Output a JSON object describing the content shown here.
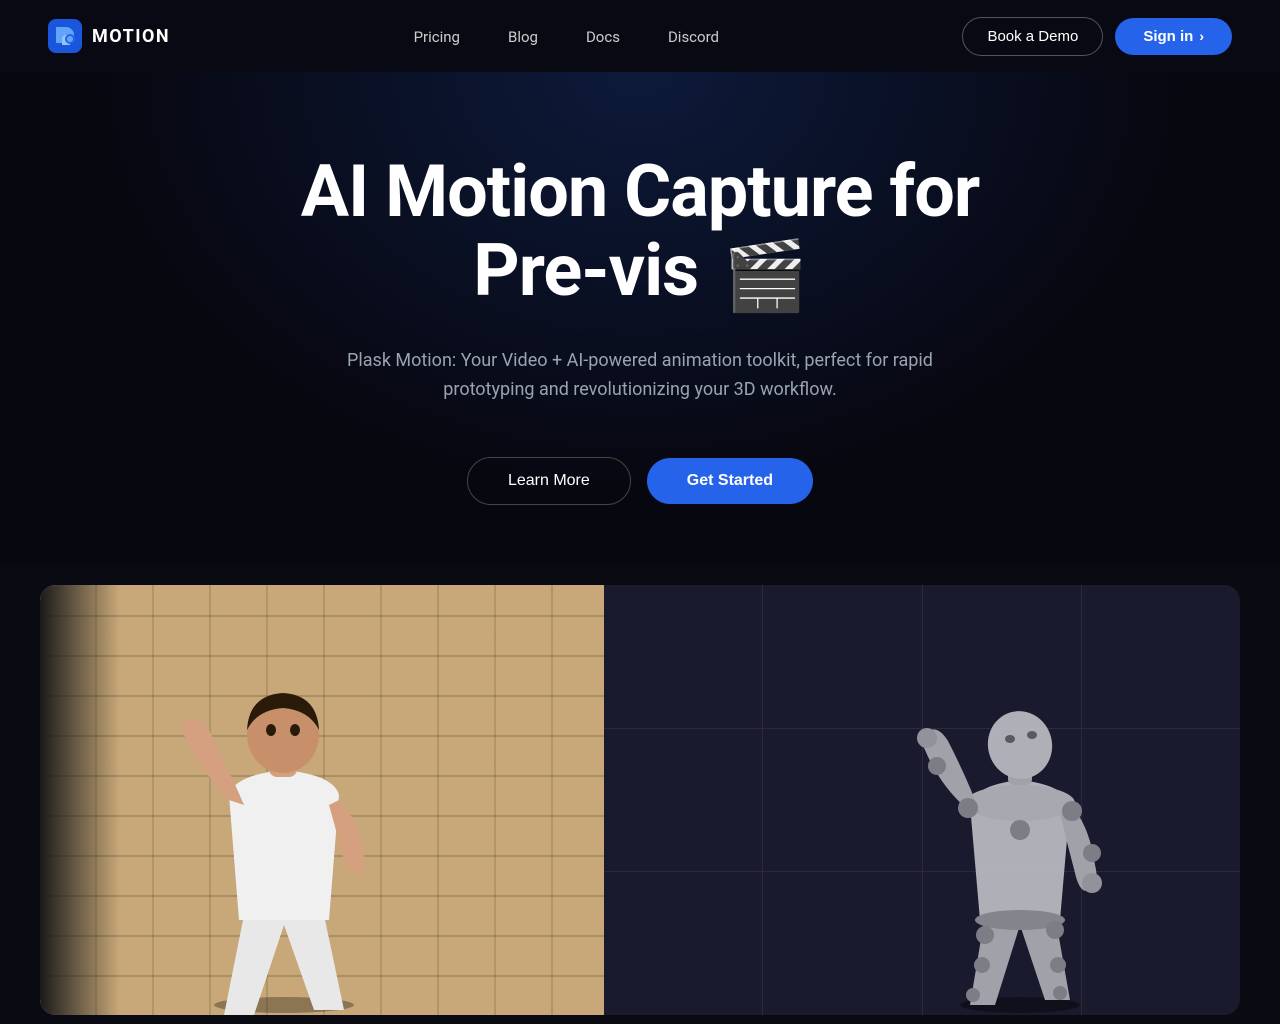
{
  "brand": {
    "logo_text": "MOTION",
    "logo_icon": "P"
  },
  "nav": {
    "links": [
      {
        "label": "Pricing",
        "href": "#"
      },
      {
        "label": "Blog",
        "href": "#"
      },
      {
        "label": "Docs",
        "href": "#"
      },
      {
        "label": "Discord",
        "href": "#"
      }
    ],
    "book_demo_label": "Book a Demo",
    "sign_in_label": "Sign in"
  },
  "hero": {
    "title_line1": "AI Motion Capture for",
    "title_line2": "Pre-vis",
    "title_emoji": "🎬",
    "subtitle": "Plask Motion: Your Video + AI-powered animation toolkit, perfect for rapid prototyping and revolutionizing your 3D workflow.",
    "btn_learn_more": "Learn More",
    "btn_get_started": "Get Started"
  },
  "colors": {
    "accent_blue": "#2563eb",
    "background": "#0a0a12",
    "nav_bg": "rgba(10,10,20,0.95)",
    "text_muted": "#9aa3b0"
  }
}
